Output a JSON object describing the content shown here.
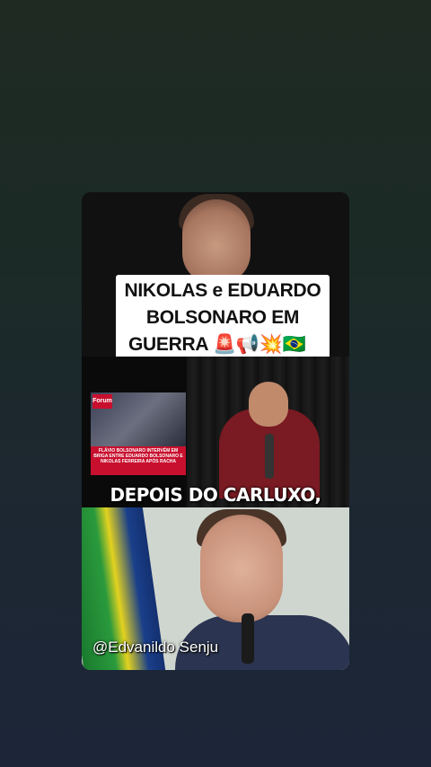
{
  "video": {
    "title_lines": [
      "NIKOLAS e EDUARDO",
      "BOLSONARO EM",
      "GUERRA 🚨📢💥🇧🇷"
    ],
    "caption": "DEPOIS DO CARLUXO,",
    "watermark": "@Edvanildo Senju",
    "news_logo": "Forum",
    "news_headline": "FLÁVIO BOLSONARO INTERVÉM EM BRIGA ENTRE EDUARDO BOLSONARO E NIKOLAS FERREIRA APÓS RACHA"
  }
}
